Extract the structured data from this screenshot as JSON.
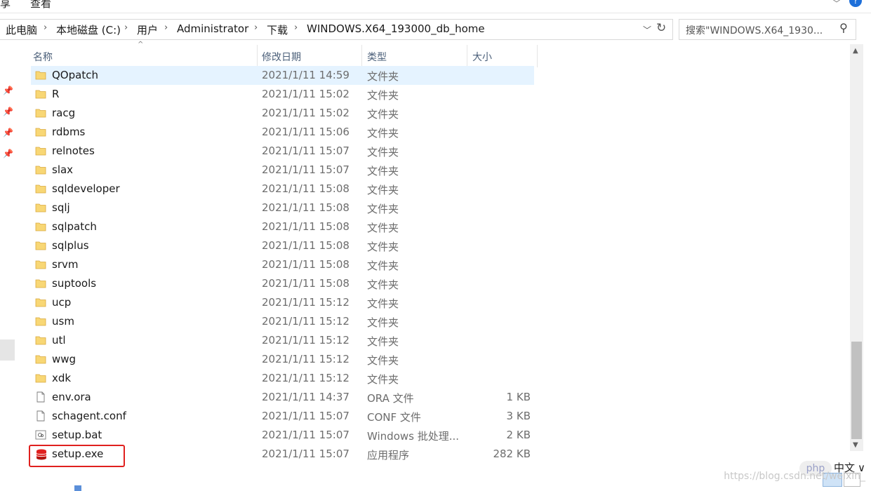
{
  "ribbon": {
    "tab_share": "享",
    "tab_view": "查看"
  },
  "address": {
    "crumbs": [
      "此电脑",
      "本地磁盘 (C:)",
      "用户",
      "Administrator",
      "下载",
      "WINDOWS.X64_193000_db_home"
    ]
  },
  "search": {
    "placeholder": "搜索\"WINDOWS.X64_1930..."
  },
  "columns": {
    "name": "名称",
    "date": "修改日期",
    "type": "类型",
    "size": "大小"
  },
  "files": [
    {
      "name": "QOpatch",
      "date": "2021/1/11 14:59",
      "type": "文件夹",
      "size": "",
      "icon": "folder-icon"
    },
    {
      "name": "R",
      "date": "2021/1/11 15:02",
      "type": "文件夹",
      "size": "",
      "icon": "folder-icon"
    },
    {
      "name": "racg",
      "date": "2021/1/11 15:02",
      "type": "文件夹",
      "size": "",
      "icon": "folder-icon"
    },
    {
      "name": "rdbms",
      "date": "2021/1/11 15:06",
      "type": "文件夹",
      "size": "",
      "icon": "folder-icon"
    },
    {
      "name": "relnotes",
      "date": "2021/1/11 15:07",
      "type": "文件夹",
      "size": "",
      "icon": "folder-icon"
    },
    {
      "name": "slax",
      "date": "2021/1/11 15:07",
      "type": "文件夹",
      "size": "",
      "icon": "folder-icon"
    },
    {
      "name": "sqldeveloper",
      "date": "2021/1/11 15:08",
      "type": "文件夹",
      "size": "",
      "icon": "folder-icon"
    },
    {
      "name": "sqlj",
      "date": "2021/1/11 15:08",
      "type": "文件夹",
      "size": "",
      "icon": "folder-icon"
    },
    {
      "name": "sqlpatch",
      "date": "2021/1/11 15:08",
      "type": "文件夹",
      "size": "",
      "icon": "folder-icon"
    },
    {
      "name": "sqlplus",
      "date": "2021/1/11 15:08",
      "type": "文件夹",
      "size": "",
      "icon": "folder-icon"
    },
    {
      "name": "srvm",
      "date": "2021/1/11 15:08",
      "type": "文件夹",
      "size": "",
      "icon": "folder-icon"
    },
    {
      "name": "suptools",
      "date": "2021/1/11 15:08",
      "type": "文件夹",
      "size": "",
      "icon": "folder-icon"
    },
    {
      "name": "ucp",
      "date": "2021/1/11 15:12",
      "type": "文件夹",
      "size": "",
      "icon": "folder-icon"
    },
    {
      "name": "usm",
      "date": "2021/1/11 15:12",
      "type": "文件夹",
      "size": "",
      "icon": "folder-icon"
    },
    {
      "name": "utl",
      "date": "2021/1/11 15:12",
      "type": "文件夹",
      "size": "",
      "icon": "folder-icon"
    },
    {
      "name": "wwg",
      "date": "2021/1/11 15:12",
      "type": "文件夹",
      "size": "",
      "icon": "folder-icon"
    },
    {
      "name": "xdk",
      "date": "2021/1/11 15:12",
      "type": "文件夹",
      "size": "",
      "icon": "folder-icon"
    },
    {
      "name": "env.ora",
      "date": "2021/1/11 14:37",
      "type": "ORA 文件",
      "size": "1 KB",
      "icon": "document-icon"
    },
    {
      "name": "schagent.conf",
      "date": "2021/1/11 15:07",
      "type": "CONF 文件",
      "size": "3 KB",
      "icon": "document-icon"
    },
    {
      "name": "setup.bat",
      "date": "2021/1/11 15:07",
      "type": "Windows 批处理...",
      "size": "2 KB",
      "icon": "batch-file-icon"
    },
    {
      "name": "setup.exe",
      "date": "2021/1/11 15:07",
      "type": "应用程序",
      "size": "282 KB",
      "icon": "oracle-setup-icon"
    }
  ],
  "overlay": {
    "php_logo": "php",
    "ime_label": "中文",
    "watermark": "https://blog.csdn.net/weixin_"
  },
  "colors": {
    "selection": "#e5f3ff",
    "highlight_box": "#e0201e",
    "folder": "#f8d775"
  }
}
